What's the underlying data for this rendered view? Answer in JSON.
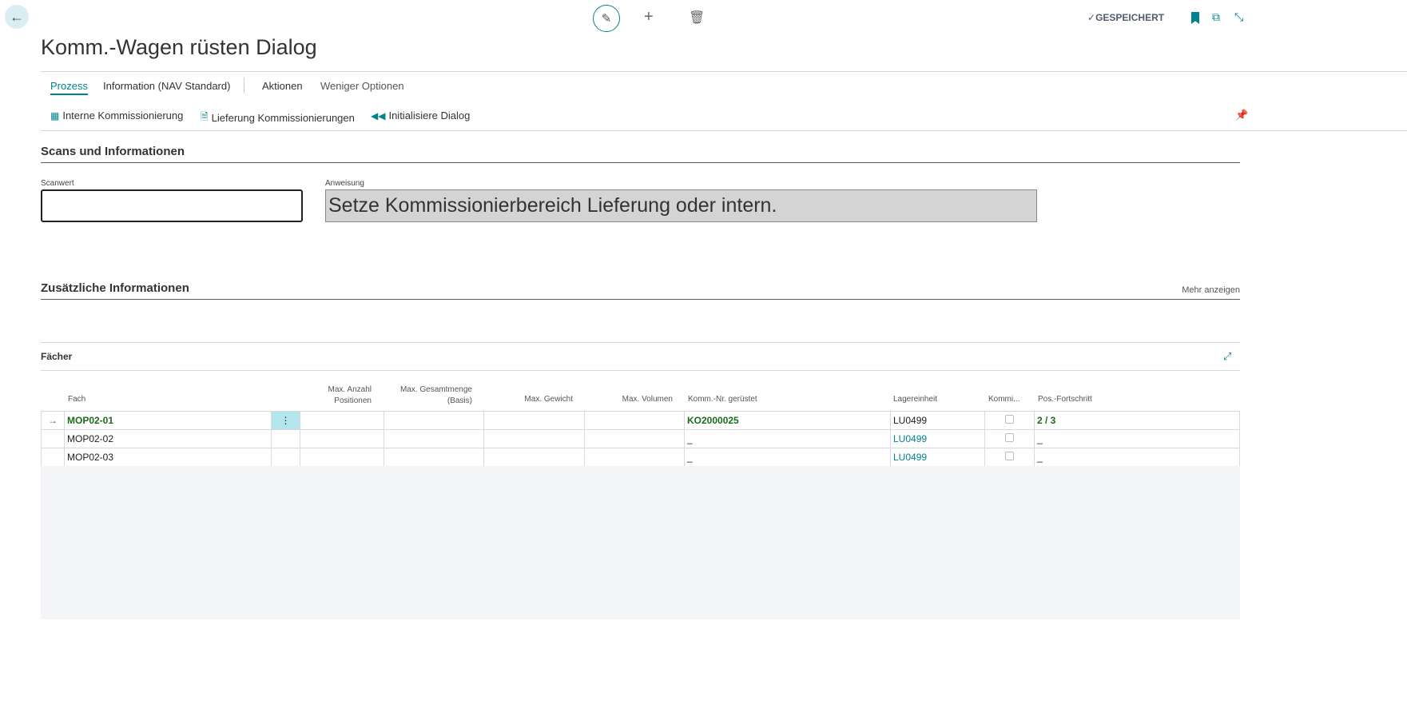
{
  "header": {
    "title": "Komm.-Wagen rüsten Dialog",
    "saved_status": "GESPEICHERT"
  },
  "tabs": [
    {
      "label": "Prozess"
    },
    {
      "label": "Information (NAV Standard)"
    },
    {
      "label": "Aktionen"
    },
    {
      "label": "Weniger Optionen"
    }
  ],
  "actions": [
    {
      "label": "Interne Kommissionierung"
    },
    {
      "label": "Lieferung Kommissionierungen"
    },
    {
      "label": "Initialisiere Dialog"
    }
  ],
  "scans": {
    "title": "Scans und Informationen",
    "scan_label": "Scanwert",
    "scan_value": "",
    "instruction_label": "Anweisung",
    "instruction_value": "Setze Kommissionierbereich Lieferung oder intern."
  },
  "additional": {
    "title": "Zusätzliche Informationen",
    "show_more": "Mehr anzeigen"
  },
  "faecher": {
    "title": "Fächer",
    "columns": [
      "Fach",
      "Max. Anzahl Positionen",
      "Max. Gesamtmenge (Basis)",
      "Max. Gewicht",
      "Max. Volumen",
      "Komm.-Nr. gerüstet",
      "Lagereinheit",
      "Kommi...",
      "Pos.-Fortschritt"
    ],
    "rows": [
      {
        "fach": "MOP02-01",
        "komm_nr": "KO2000025",
        "lagereinheit": "LU0499",
        "kommi": false,
        "fortschritt": "2 / 3",
        "selected": true
      },
      {
        "fach": "MOP02-02",
        "komm_nr": "_",
        "lagereinheit": "LU0499",
        "kommi": false,
        "fortschritt": "_"
      },
      {
        "fach": "MOP02-03",
        "komm_nr": "_",
        "lagereinheit": "LU0499",
        "kommi": false,
        "fortschritt": "_"
      }
    ]
  }
}
